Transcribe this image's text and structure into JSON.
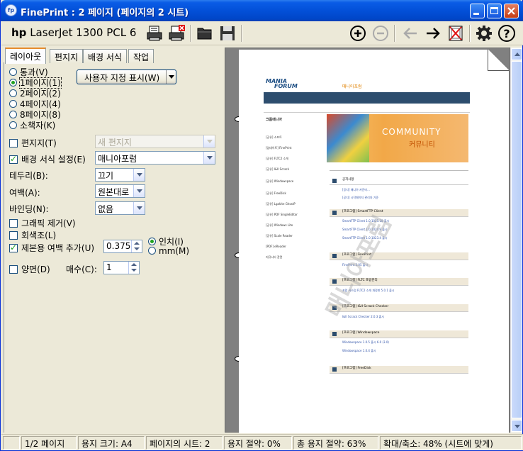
{
  "window": {
    "title": "FinePrint : 2 페이지 (페이지의 2 시트)",
    "app_icon": "fp"
  },
  "toolbar": {
    "printer_name_brand": "hp",
    "printer_name_model": "LaserJet 1300 PCL 6"
  },
  "tabs": [
    "레이아웃",
    "편지지",
    "배경 서식",
    "작업"
  ],
  "layout": {
    "radio_options": [
      "통과(V)",
      "1페이지(1)",
      "2페이지(2)",
      "4페이지(4)",
      "8페이지(8)",
      "소책자(K)"
    ],
    "selected": "1페이지(1)",
    "custom_display_button": "사용자 지정 표시(W)",
    "letterhead_label": "편지지(T)",
    "letterhead_value": "새 편지지",
    "background_label": "배경 서식 설정(E)",
    "background_value": "매니아포럼",
    "border_label": "테두리(B):",
    "border_value": "끄기",
    "margin_label": "여백(A):",
    "margin_value": "원본대로",
    "binding_label": "바인딩(N):",
    "binding_value": "없음",
    "remove_graphics_label": "그래픽 제거(V)",
    "grayscale_label": "회색조(L)",
    "gutter_label": "제본용 여백 추가(U)",
    "gutter_value": "0.375",
    "unit_inch": "인치(I)",
    "unit_mm": "mm(M)",
    "duplex_label": "양면(D)",
    "copies_label": "매수(C):",
    "copies_value": "1"
  },
  "preview": {
    "page_number": "1",
    "site_logo_line1": "MANIA",
    "site_logo_line2": "FORUM",
    "site_tagline": "매니아포럼",
    "banner_text": "COMMUNITY",
    "banner_text_kr": "커뮤니티",
    "watermark": "매니아포럼",
    "sidebar_items": [
      "크롬매니아",
      "[공유] 소프트",
      "[업데이트] FinePrint",
      "[공유] FLTC2 소개",
      "[공유] I&II Scrack",
      "[공유] Windowspace",
      "[공유] FreeDisk",
      "[공유] Lgakite GhostP",
      "[공유] PDF SingleEditor",
      "[공유] Windows Lite",
      "[공유] Scale Reader",
      "[PDF] eReader",
      "커뮤니티 관련"
    ],
    "sections": [
      {
        "title": "공지사항",
        "lines": [
          "[공지] 매니아 카운터...",
          "[공지] 시작페이지 관리자 기준"
        ]
      },
      {
        "title": "[프로그램] SmartFTP Client",
        "lines": [
          "SmartFTP Client 1.0.1025.18 출시",
          "SmartFTP Client 1.0.1024.9 출시",
          "SmartFTP Client 1.0.1023.4 출시"
        ]
      },
      {
        "title": "[프로그램] FinePrint",
        "lines": [
          "FinePrint 5.05 출시"
        ]
      },
      {
        "title": "[프로그램] FLTC 포럼관리",
        "lines": [
          "포럼 커스텀 FLTC2 소개 개정판 5.0.1 출시"
        ]
      },
      {
        "title": "[프로그램] I&II Scrack Checker",
        "lines": [
          "I&II Scrack Checker 2.0.3 출시"
        ]
      },
      {
        "title": "[프로그램] Windowspace",
        "lines": [
          "Windowspace 1.0.5 출시 6.0 (3.0)",
          "Windowspace 1.0.4 출시"
        ]
      },
      {
        "title": "[프로그램] FreeDisk",
        "lines": []
      }
    ]
  },
  "status": {
    "pages": "1/2 페이지",
    "paper_size": "용지 크기: A4",
    "sheets": "페이지의 시트: 2",
    "paper_saving": "용지 절약: 0%",
    "total_saving": "총 용지 절약: 63%",
    "zoom": "확대/축소: 48% (시트에 맞게)"
  },
  "colors": {
    "title_bar": "#0350d8",
    "site_header": "#2d4d6e",
    "banner_orange": "#f0a040"
  }
}
